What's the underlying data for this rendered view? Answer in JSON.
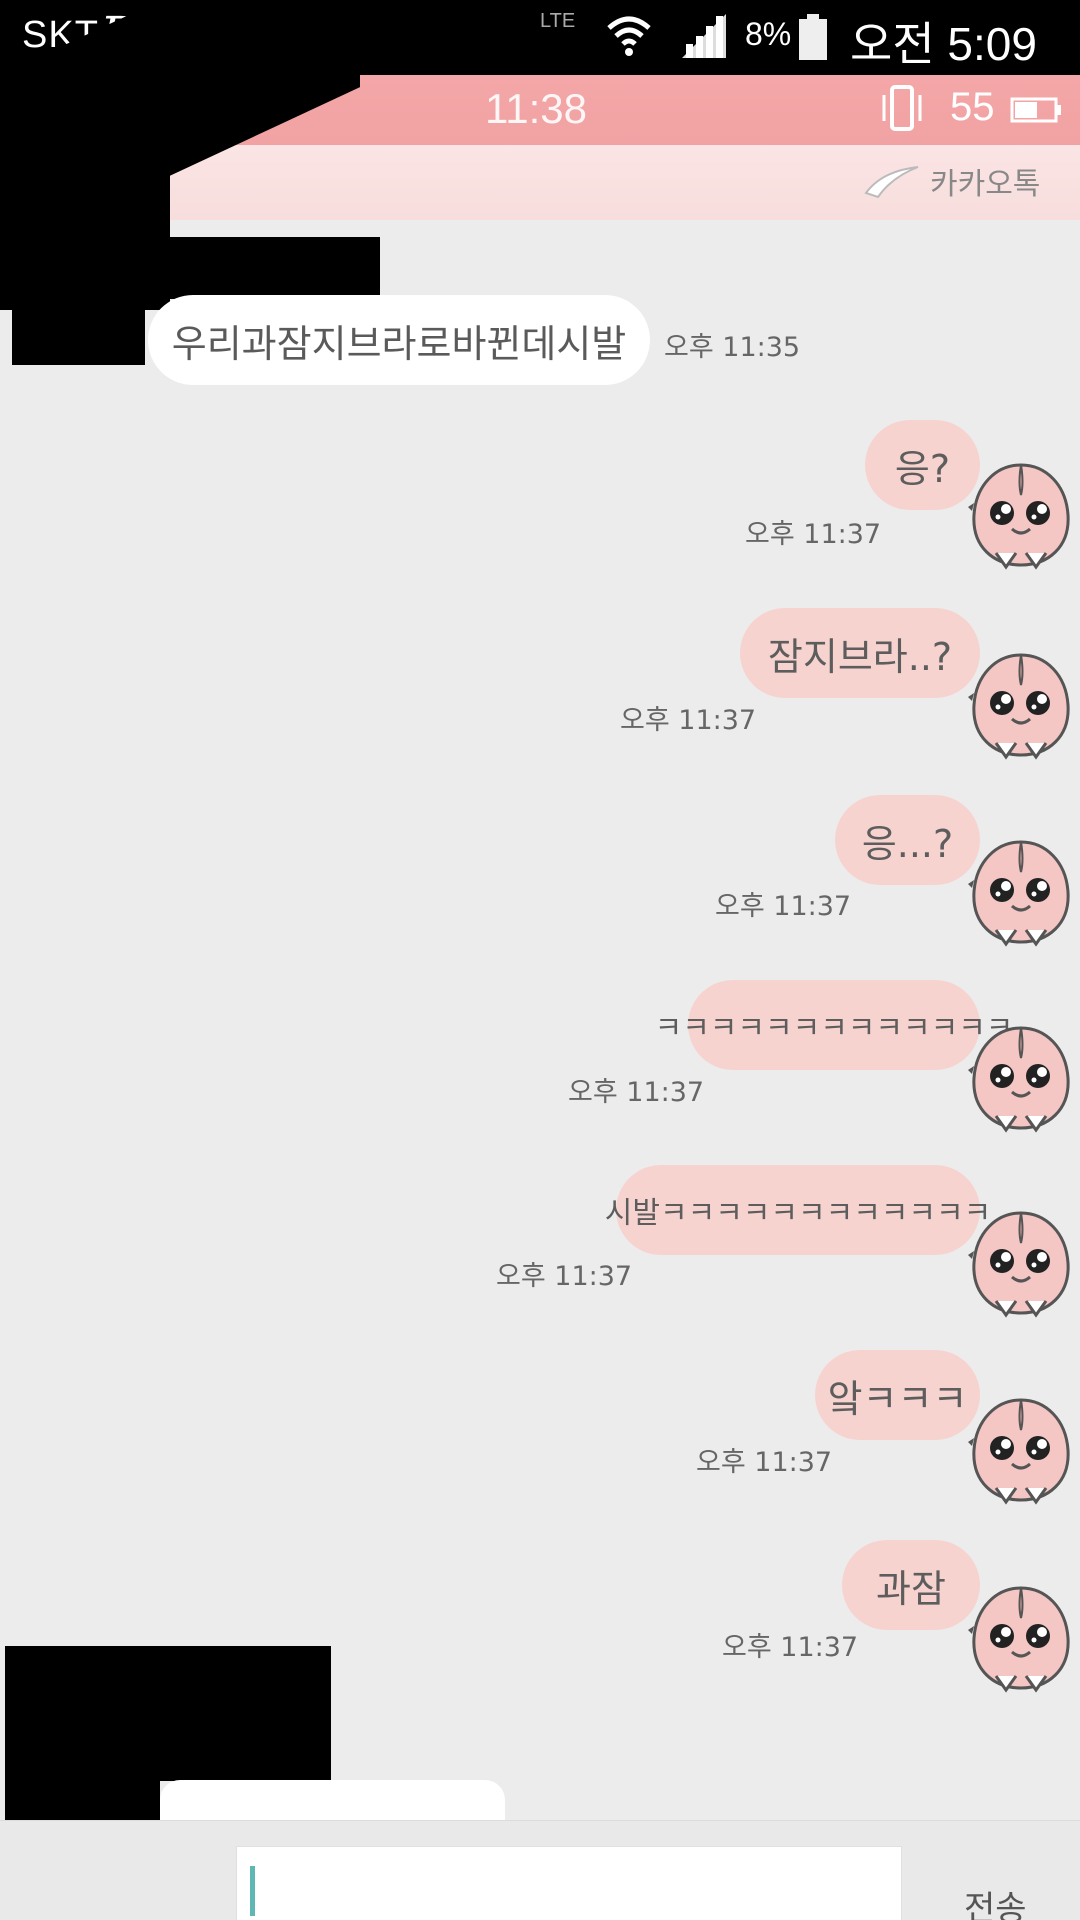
{
  "system_status": {
    "carrier": "SKT",
    "carrier_logo": "D",
    "network": "LTE",
    "battery_percent": "8%",
    "time": "오전 5:09"
  },
  "inner_status": {
    "time": "11:38",
    "battery": "55"
  },
  "room": {
    "app_logo": "카카오톡"
  },
  "messages": [
    {
      "direction": "incoming",
      "text": "우리과잠지브라로바뀐데시발",
      "time": "오후 11:35"
    },
    {
      "direction": "outgoing",
      "text": "응?",
      "time": "오후 11:37"
    },
    {
      "direction": "outgoing",
      "text": "잠지브라..?",
      "time": "오후 11:37"
    },
    {
      "direction": "outgoing",
      "text": "응...?",
      "time": "오후 11:37"
    },
    {
      "direction": "outgoing",
      "text": "ㅋㅋㅋㅋㅋㅋㅋㅋㅋㅋㅋㅋㅋ",
      "time": "오후 11:37"
    },
    {
      "direction": "outgoing",
      "text": "시발ㅋㅋㅋㅋㅋㅋㅋㅋㅋㅋㅋㅋ",
      "time": "오후 11:37"
    },
    {
      "direction": "outgoing",
      "text": "앜ㅋㅋㅋ",
      "time": "오후 11:37"
    },
    {
      "direction": "outgoing",
      "text": "과잠",
      "time": "오후 11:37"
    }
  ],
  "composer": {
    "send_label": "전송"
  },
  "colors": {
    "header_pink": "#f1a2a3",
    "outgoing_bubble": "#f7d3d0",
    "incoming_bubble": "#ffffff",
    "chat_background": "#ececec"
  },
  "icons": {
    "heart": "heart-icon",
    "wifi": "wifi-icon",
    "signal": "signal-icon",
    "battery": "battery-icon",
    "vibrate": "vibrate-icon",
    "avatar": "apeach-avatar-icon"
  }
}
